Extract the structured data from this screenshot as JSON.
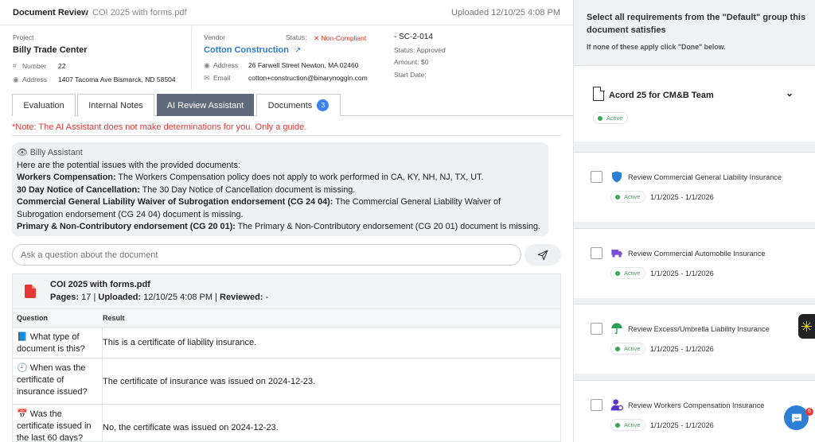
{
  "header": {
    "title": "Document Review",
    "filename": "COI 2025 with forms.pdf",
    "uploaded": "Uploaded 12/10/25 4:08 PM"
  },
  "project": {
    "label": "Project",
    "name": "Billy Trade Center",
    "number_label": "Number",
    "number": "22",
    "address_label": "Address",
    "address": "1407 Tacoma Ave Bismarck, ND 58504"
  },
  "vendor": {
    "label": "Vendor",
    "name": "Cotton Construction",
    "status_label": "Status:",
    "status": "Non-Compliant",
    "address_label": "Address",
    "address": "26 Farwell Street Newton, MA 02460",
    "email_label": "Email",
    "email": "cotton+construction@binarynoggin.com"
  },
  "contract": {
    "id": "- SC-2-014",
    "status": "Status: Approved",
    "amount": "Amount: $0",
    "start": "Start Date:"
  },
  "tabs": [
    {
      "label": "Evaluation"
    },
    {
      "label": "Internal Notes"
    },
    {
      "label": "AI Review Assistant"
    },
    {
      "label": "Documents",
      "badge": "3"
    }
  ],
  "note": "*Note: The AI Assistant does not make determinations for you. Only a guide.",
  "assistant": {
    "name": "Billy Assistant",
    "intro": "Here are the potential issues with the provided documents:",
    "issues": [
      {
        "title": "Workers Compensation:",
        "text": " The Workers Compensation policy does not apply to work performed in CA, KY, NH, NJ, TX, UT."
      },
      {
        "title": "30 Day Notice of Cancellation:",
        "text": " The 30 Day Notice of Cancellation document is missing."
      },
      {
        "title": "Commercial General Liability Waiver of Subrogation endorsement (CG 24 04):",
        "text": " The Commercial General Liability Waiver of Subrogation endorsement (CG 24 04) document is missing."
      },
      {
        "title": "Primary & Non-Contributory endorsement (CG 20 01):",
        "text": " The Primary & Non-Contributory endorsement (CG 20 01) document is missing."
      }
    ]
  },
  "ask": {
    "placeholder": "Ask a question about the document"
  },
  "document": {
    "title": "COI 2025 with forms.pdf",
    "pages_label": "Pages:",
    "pages": "17",
    "uploaded_label": "Uploaded:",
    "uploaded": "12/10/25 4:08 PM",
    "reviewed_label": "Reviewed:",
    "reviewed": "-"
  },
  "table": {
    "headers": [
      "Question",
      "Result"
    ],
    "rows": [
      {
        "icon": "📘",
        "question_lines": [
          "What type of",
          "document is this?"
        ],
        "result": "This is a certificate of liability insurance."
      },
      {
        "icon": "🕘",
        "question_lines": [
          "When was the",
          "certificate of",
          "insurance issued?"
        ],
        "result": "The certificate of insurance was issued on 2024-12-23."
      },
      {
        "icon": "📅",
        "question_lines": [
          "Was the",
          "certificate issued in",
          "the last 60 days?"
        ],
        "result": "No, the certificate was issued on 2024-12-23."
      }
    ]
  },
  "right": {
    "heading": "Select all requirements from the \"Default\" group this document satisfies",
    "sub": "If none of these apply click \"Done\" below.",
    "group": {
      "name": "Acord 25 for CM&B Team",
      "status": "Active"
    },
    "items": [
      {
        "label": "Review Commercial General Liability Insurance",
        "status": "Active",
        "dates": "1/1/2025 - 1/1/2026",
        "icon": "shield-icon",
        "color": "#2d7fd6"
      },
      {
        "label": "Review Commercial Automobile Insurance",
        "status": "Active",
        "dates": "1/1/2025 - 1/1/2026",
        "icon": "truck-icon",
        "color": "#7b4fd6"
      },
      {
        "label": "Review Excess/Umbrella Liability Insurance",
        "status": "Active",
        "dates": "1/1/2025 - 1/1/2026",
        "icon": "umbrella-icon",
        "color": "#2e9d5b"
      },
      {
        "label": "Review Workers Compensation Insurance",
        "status": "Active",
        "dates": "1/1/2025 - 1/1/2026",
        "icon": "worker-icon",
        "color": "#5b35c8"
      }
    ]
  },
  "chat": {
    "badge": "6"
  },
  "colors": {
    "accent": "#2b7bd3",
    "error": "#e53935",
    "active": "#3aa757",
    "tab_active": "#5f6b7a"
  }
}
